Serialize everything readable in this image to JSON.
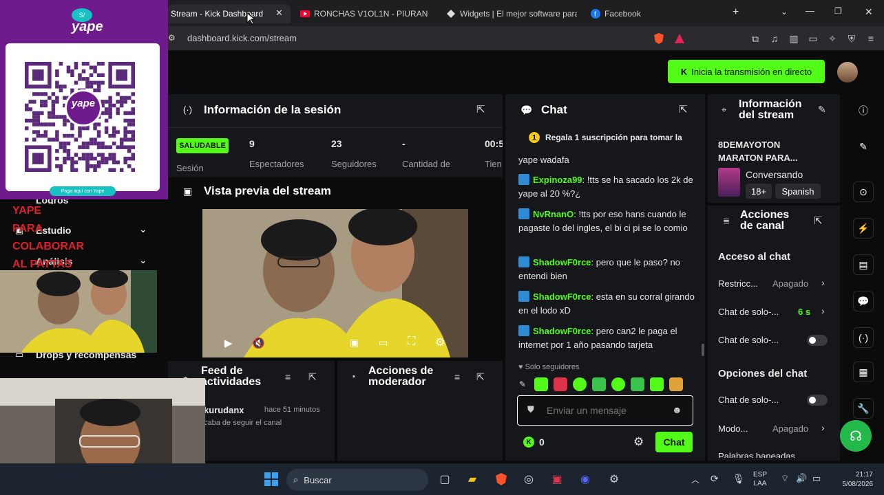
{
  "browser": {
    "tabs": [
      {
        "label": "Stream - Kick Dashboard",
        "active": true
      },
      {
        "label": "RONCHAS V1OL1N - PIURAN"
      },
      {
        "label": "Widgets | El mejor software para"
      },
      {
        "label": "Facebook"
      }
    ],
    "new_tab": "+",
    "url": "dashboard.kick.com/stream"
  },
  "header": {
    "go_live_label": "Inicia la transmisión en directo"
  },
  "session": {
    "title": "Información de la sesión",
    "status_badge": "SALUDABLE",
    "status_label": "Sesión",
    "stats": [
      {
        "value": "9",
        "label": "Espectadores"
      },
      {
        "value": "23",
        "label": "Seguidores"
      },
      {
        "value": "-",
        "label": "Cantidad de"
      },
      {
        "value": "00:5",
        "label": "Tien"
      }
    ]
  },
  "preview": {
    "title": "Vista previa del stream"
  },
  "feed": {
    "title_line1": "Feed de",
    "title_line2": "actividades",
    "item_user": "kurudanx",
    "item_time": "hace 51 minutos",
    "item_text": "caba de seguir el canal"
  },
  "moderator": {
    "title_line1": "Acciones de",
    "title_line2": "moderador"
  },
  "chat": {
    "title": "Chat",
    "pinned": "Regala 1 suscripción para tomar la",
    "partial_line": "yape wadafa",
    "messages": [
      {
        "user": "Expinoza99",
        "text": ": !tts se ha sacado los 2k de yape al 20 %?¿"
      },
      {
        "user": "NvRnanO",
        "text": ": !tts por eso hans cuando le pagaste lo del ingles, el bi ci pi se lo comio"
      },
      {
        "user": "ShadowF0rce",
        "text": ": pero que le paso? no entendi bien"
      },
      {
        "user": "ShadowF0rce",
        "text": ": esta en su corral girando en el lodo xD"
      },
      {
        "user": "ShadowF0rce",
        "text": ": pero can2 le paga el internet por 1 año pasando tarjeta"
      }
    ],
    "followers_only": "Solo seguidores",
    "input_placeholder": "Enviar un mensaje",
    "points": "0",
    "send_label": "Chat"
  },
  "stream_info": {
    "title_line1": "Información",
    "title_line2": "del stream",
    "stream_title_line1": "8DEMAYOTON",
    "stream_title_line2": "MARATON PARA...",
    "category": "Conversando",
    "tags": [
      "18+",
      "Spanish"
    ]
  },
  "channel_actions": {
    "title_line1": "Acciones",
    "title_line2": "de canal",
    "chat_access_title": "Acceso al chat",
    "rows": [
      {
        "label": "Restricc...",
        "value": "Apagado"
      },
      {
        "label": "Chat de solo-...",
        "value": "6 s"
      },
      {
        "label": "Chat de solo-..."
      }
    ],
    "chat_options_title": "Opciones del chat",
    "options_rows": [
      {
        "label": "Chat de solo-..."
      },
      {
        "label": "Modo...",
        "value": "Apagado"
      },
      {
        "label": "Palabras baneadas"
      }
    ]
  },
  "sidebar": {
    "items": [
      {
        "label": "Logros"
      },
      {
        "label": "Estudio"
      },
      {
        "label": "Análisis"
      },
      {
        "label": "Drops y recompensas"
      }
    ]
  },
  "overlay": {
    "yape_logo": "yape",
    "yape_footer": "Paga aquí con Yape",
    "qr_brand": "yape",
    "overlay_text": [
      "YAPE",
      "PARA",
      "COLABORAR",
      "AL PAYTAS"
    ]
  },
  "taskbar": {
    "search_label": "Buscar",
    "lang_line1": "ESP",
    "lang_line2": "LAA",
    "time": "21:17",
    "date": "5/08/2026"
  },
  "colors": {
    "accent": "#53fc18",
    "background": "#0b0b0c",
    "panel": "#16171a",
    "yape_purple": "#6e1b8e",
    "badge_blue": "#2e8bd6"
  }
}
